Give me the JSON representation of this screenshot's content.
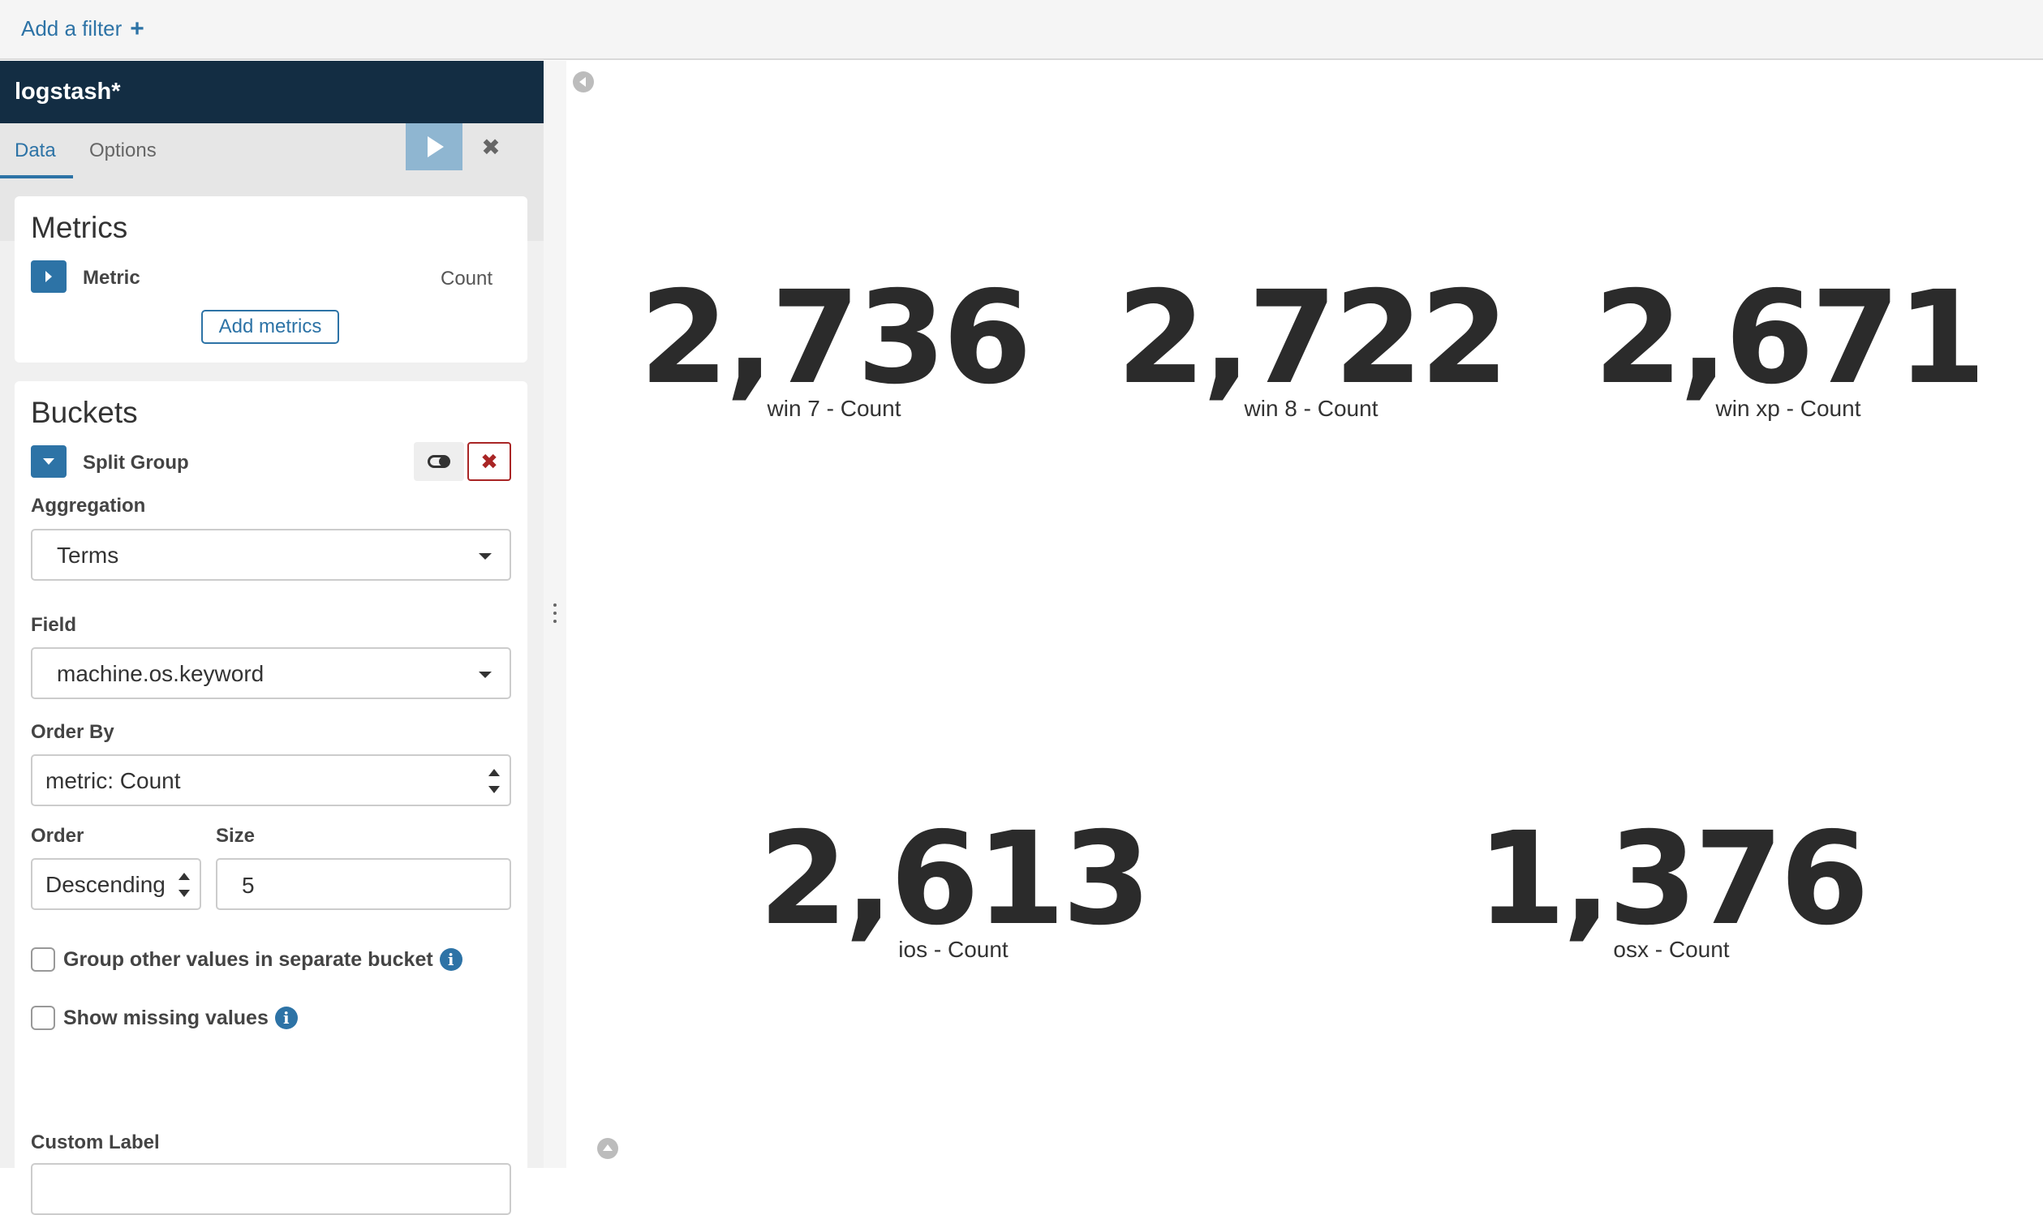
{
  "filter_bar": {
    "add_filter_label": "Add a filter"
  },
  "sidebar": {
    "index_pattern": "logstash*",
    "tabs": [
      {
        "label": "Data"
      },
      {
        "label": "Options"
      }
    ],
    "metrics": {
      "title": "Metrics",
      "items": [
        {
          "label": "Metric",
          "aggregation": "Count"
        }
      ],
      "add_button": "Add metrics"
    },
    "buckets": {
      "title": "Buckets",
      "group_label": "Split Group",
      "aggregation_label": "Aggregation",
      "aggregation_value": "Terms",
      "field_label": "Field",
      "field_value": "machine.os.keyword",
      "order_by_label": "Order By",
      "order_by_value": "metric: Count",
      "order_label": "Order",
      "order_value": "Descending",
      "size_label": "Size",
      "size_value": "5",
      "other_bucket_label": "Group other values in separate bucket",
      "missing_label": "Show missing values",
      "custom_label_label": "Custom Label",
      "custom_label_value": ""
    }
  },
  "visualization": {
    "metrics": [
      {
        "value": "2,736",
        "label": "win 7 - Count"
      },
      {
        "value": "2,722",
        "label": "win 8 - Count"
      },
      {
        "value": "2,671",
        "label": "win xp - Count"
      },
      {
        "value": "2,613",
        "label": "ios - Count"
      },
      {
        "value": "1,376",
        "label": "osx - Count"
      }
    ]
  },
  "colors": {
    "accent": "#2d73a6",
    "header_bg": "#132d43",
    "danger": "#a92525"
  }
}
